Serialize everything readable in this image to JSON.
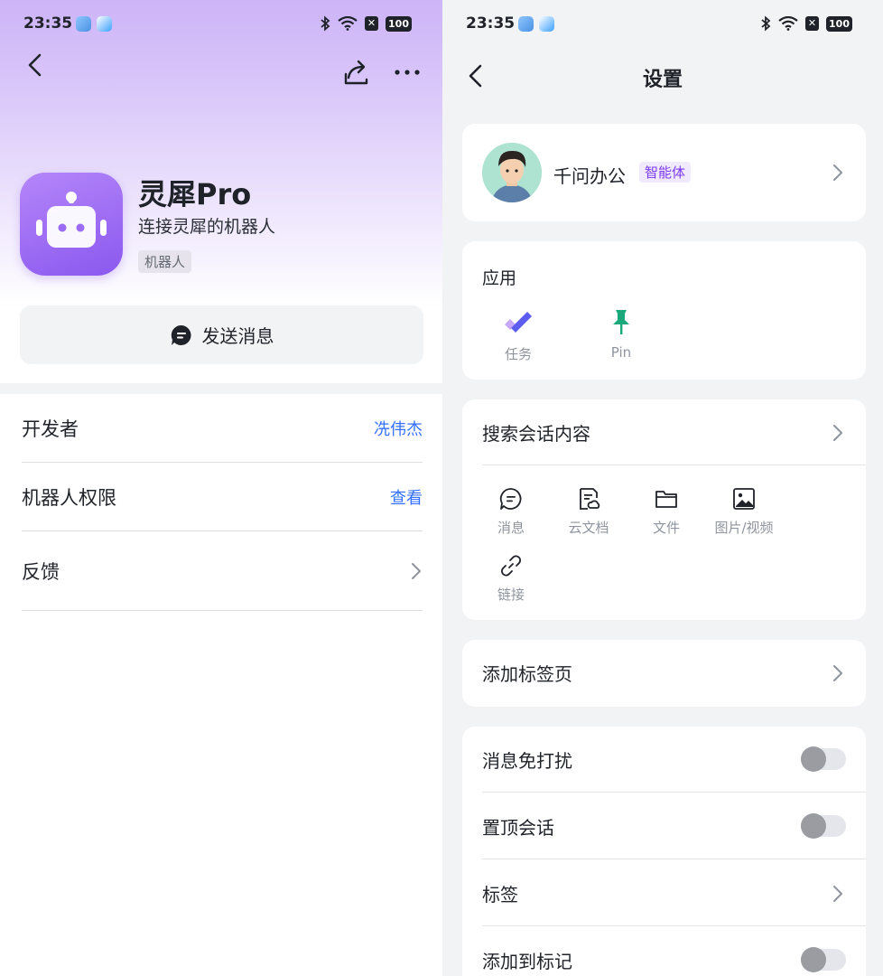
{
  "status_bar": {
    "time": "23:35",
    "battery": "100"
  },
  "left": {
    "app_name": "灵犀Pro",
    "app_desc": "连接灵犀的机器人",
    "tag": "机器人",
    "send_button": "发送消息",
    "rows": [
      {
        "label": "开发者",
        "value": "冼伟杰"
      },
      {
        "label": "机器人权限",
        "value": "查看"
      },
      {
        "label": "反馈",
        "value": ""
      }
    ]
  },
  "right": {
    "title": "设置",
    "profile": {
      "name": "千问办公",
      "tag": "智能体"
    },
    "apps_section": {
      "title": "应用",
      "items": [
        {
          "label": "任务",
          "icon": "task-icon"
        },
        {
          "label": "Pin",
          "icon": "pin-icon"
        }
      ]
    },
    "search_section": {
      "title": "搜索会话内容",
      "items": [
        {
          "label": "消息",
          "icon": "message-icon"
        },
        {
          "label": "云文档",
          "icon": "cloud-doc-icon"
        },
        {
          "label": "文件",
          "icon": "folder-icon"
        },
        {
          "label": "图片/视频",
          "icon": "image-icon"
        },
        {
          "label": "链接",
          "icon": "link-icon"
        }
      ]
    },
    "add_tab": "添加标签页",
    "settings": [
      {
        "label": "消息免打扰",
        "type": "toggle",
        "on": false
      },
      {
        "label": "置顶会话",
        "type": "toggle",
        "on": false
      },
      {
        "label": "标签",
        "type": "chevron"
      },
      {
        "label": "添加到标记",
        "type": "toggle",
        "on": false
      }
    ]
  },
  "colors": {
    "accent": "#3370ff",
    "robot_purple": "#8b58ef",
    "agent_tag": "#7c3aed"
  }
}
